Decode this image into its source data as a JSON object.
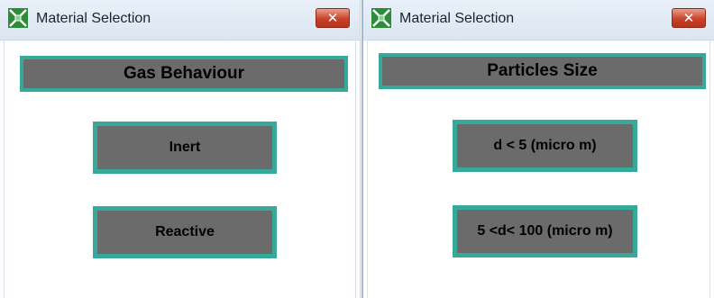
{
  "windows": [
    {
      "title": "Material Selection",
      "close_label": "✕",
      "heading": "Gas Behaviour",
      "options": [
        "Inert",
        "Reactive"
      ]
    },
    {
      "title": "Material Selection",
      "close_label": "✕",
      "heading": "Particles Size",
      "options": [
        "d < 5 (micro m)",
        "5 <d< 100 (micro m)"
      ]
    }
  ],
  "colors": {
    "button_fill": "#6b6b6b",
    "button_border": "#36a99a",
    "close_button": "#c9422a",
    "icon_green": "#2e8b3a"
  },
  "icons": {
    "app": "green-diamond-grid-icon",
    "close": "close-icon"
  }
}
